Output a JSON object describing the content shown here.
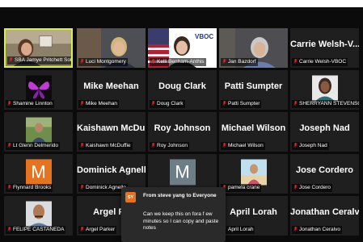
{
  "participants": [
    {
      "id": "jamye",
      "label": "SBA Jamye Pritchett Solor",
      "display": "",
      "kind": "video",
      "active": true
    },
    {
      "id": "luci",
      "label": "Luci Montgomery",
      "display": "",
      "kind": "video"
    },
    {
      "id": "kelli",
      "label": "Kelli Benham-Anthis",
      "display": "",
      "kind": "video"
    },
    {
      "id": "jan",
      "label": "Jan Bazdorf",
      "display": "",
      "kind": "video"
    },
    {
      "id": "carrie",
      "label": "Carrie Welsh-VBOC",
      "display": "Carrie  Welsh-V...",
      "kind": "name"
    },
    {
      "id": "shamine",
      "label": "Shamine Linnton",
      "display": "",
      "kind": "butterfly"
    },
    {
      "id": "mike",
      "label": "Mike Meehan",
      "display": "Mike Meehan",
      "kind": "name"
    },
    {
      "id": "doug",
      "label": "Doug Clark",
      "display": "Doug Clark",
      "kind": "name"
    },
    {
      "id": "patti",
      "label": "Patti Sumpter",
      "display": "Patti Sumpter",
      "kind": "name"
    },
    {
      "id": "sherryann",
      "label": "SHERRYANN STEVENSON",
      "display": "",
      "kind": "portrait"
    },
    {
      "id": "glenn",
      "label": "Lt Glenn Delmerido",
      "display": "",
      "kind": "outdoor"
    },
    {
      "id": "kaishawn",
      "label": "Kaishawn McDuffie",
      "display": "Kaishawn  McDu...",
      "kind": "name"
    },
    {
      "id": "roy",
      "label": "Roy Johnson",
      "display": "Roy Johnson",
      "kind": "name"
    },
    {
      "id": "michael",
      "label": "Michael Wilson",
      "display": "Michael Wilson",
      "kind": "name"
    },
    {
      "id": "joseph",
      "label": "Joseph Nad",
      "display": "Joseph Nad",
      "kind": "name"
    },
    {
      "id": "flynnard",
      "label": "Flynnard Brooks",
      "display": "",
      "kind": "letter",
      "letter": "M",
      "color": "#e8731f"
    },
    {
      "id": "dominick",
      "label": "Dominick Agnello",
      "display": "Dominick Agnello",
      "kind": "name"
    },
    {
      "id": "mgray",
      "label": "",
      "display": "",
      "kind": "letter",
      "letter": "M",
      "color": "#6e7e86"
    },
    {
      "id": "pamela",
      "label": "pamela crane",
      "display": "",
      "kind": "beach"
    },
    {
      "id": "jose",
      "label": "Jose Cordero",
      "display": "Jose Cordero",
      "kind": "name"
    },
    {
      "id": "felipe",
      "label": "FELIPE CASTANEDA",
      "display": "",
      "kind": "man"
    },
    {
      "id": "argel",
      "label": "Argel Parker",
      "display": "Argel Pa",
      "kind": "name"
    },
    {
      "id": "blank",
      "label": "",
      "display": "",
      "kind": "empty"
    },
    {
      "id": "april",
      "label": "April Lorah",
      "display": "April Lorah",
      "kind": "name"
    },
    {
      "id": "jonathan",
      "label": "Jonathan Ceralvo",
      "display": "Jonathan Ceralvo",
      "kind": "name"
    }
  ],
  "chat": {
    "initials": "SY",
    "header": "From steve yang to Everyone",
    "message": "Can we keep this on fora f ew minutes so I can copy and paste notes"
  },
  "colors": {
    "active_border": "#d6ef4a",
    "mic_muted": "#e0282e",
    "avatar_orange": "#e8731f"
  }
}
